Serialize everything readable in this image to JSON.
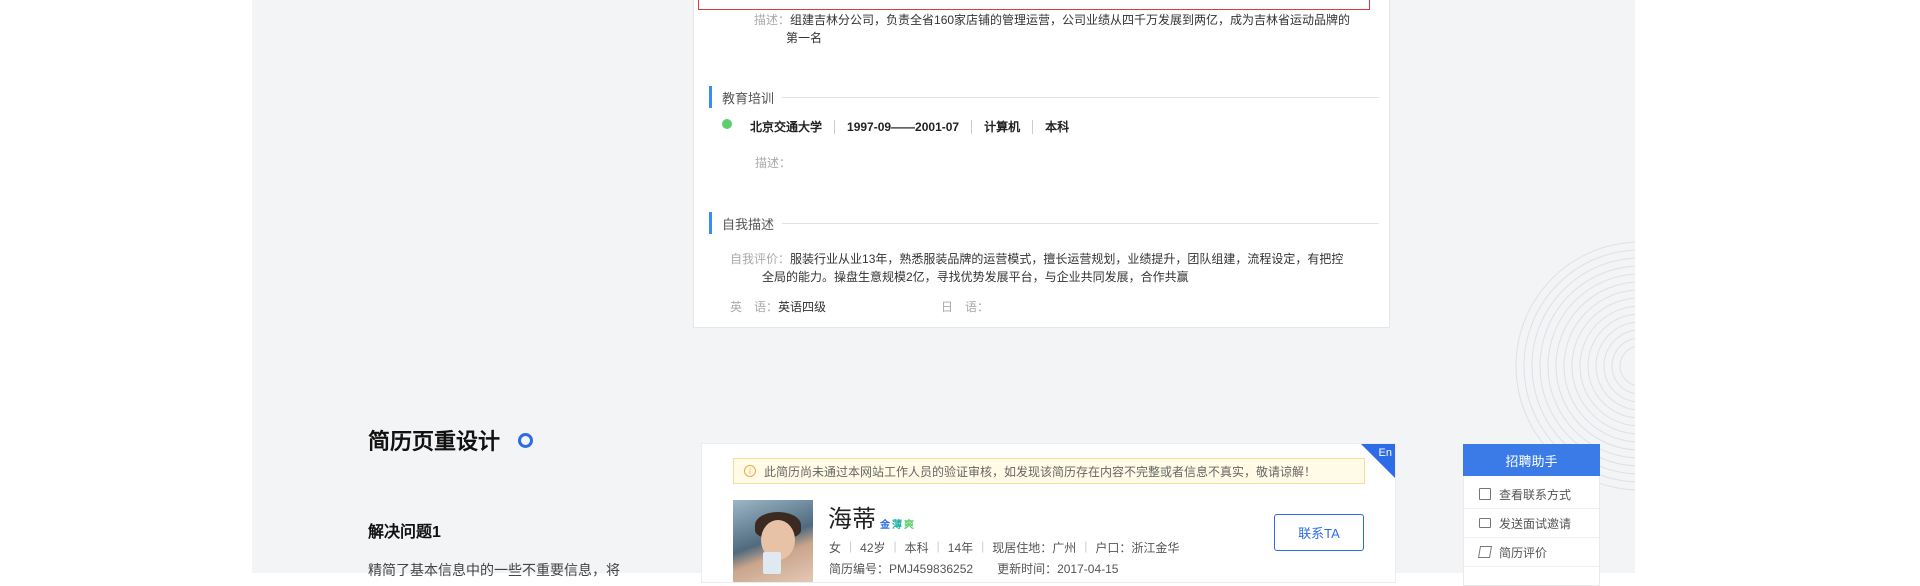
{
  "top_card": {
    "desc_label": "描述：",
    "desc_text": "组建吉林分公司，负责全省160家店铺的管理运营，公司业绩从四千万发展到两亿，成为吉林省运动品牌的",
    "desc_text_cont": "第一名",
    "education": {
      "title": "教育培训",
      "school": "北京交通大学",
      "period": "1997-09——2001-07",
      "major": "计算机",
      "degree": "本科",
      "desc_label": "描述："
    },
    "self_description": {
      "title": "自我描述",
      "eval_label": "自我评价：",
      "eval_text": "服装行业从业13年，熟悉服装品牌的运营模式，擅长运营规划，业绩提升，团队组建，流程设定，有把控",
      "eval_text_cont": "全局的能力。操盘生意规模2亿，寻找优势发展平台，与企业共同发展，合作共赢",
      "english_label": "英　语：",
      "english_value": "英语四级",
      "japanese_label": "日　语："
    }
  },
  "section": {
    "heading": "简历页重设计",
    "subheading": "解决问题1",
    "body": "精简了基本信息中的一些不重要信息，将"
  },
  "bottom_card": {
    "corner_label": "En",
    "notice": "此简历尚未通过本网站工作人员的验证审核，如发现该简历存在内容不完整或者信息不真实，敬请谅解！",
    "name": "海蒂",
    "badges": [
      {
        "text": "金",
        "color": "#2e6be6"
      },
      {
        "text": "薄",
        "color": "#2bb3a5"
      },
      {
        "text": "爽",
        "color": "#5ccf6c"
      }
    ],
    "gender": "女",
    "age": "42岁",
    "education": "本科",
    "experience": "14年",
    "residence": "现居住地：广州",
    "hukou": "户口：浙江金华",
    "resume_id": "简历编号：PMJ459836252",
    "updated": "更新时间：2017-04-15",
    "contact_button": "联系TA"
  },
  "assistant": {
    "title": "招聘助手",
    "items": [
      {
        "label": "查看联系方式",
        "icon": "contact-card-icon"
      },
      {
        "label": "发送面试邀请",
        "icon": "envelope-icon"
      },
      {
        "label": "简历评价",
        "icon": "edit-icon"
      }
    ]
  },
  "colors": {
    "accent": "#2e6be6",
    "section_bar": "#3b8cf0",
    "dot_green": "#5ccf6c",
    "highlight_red": "#e0383b"
  }
}
